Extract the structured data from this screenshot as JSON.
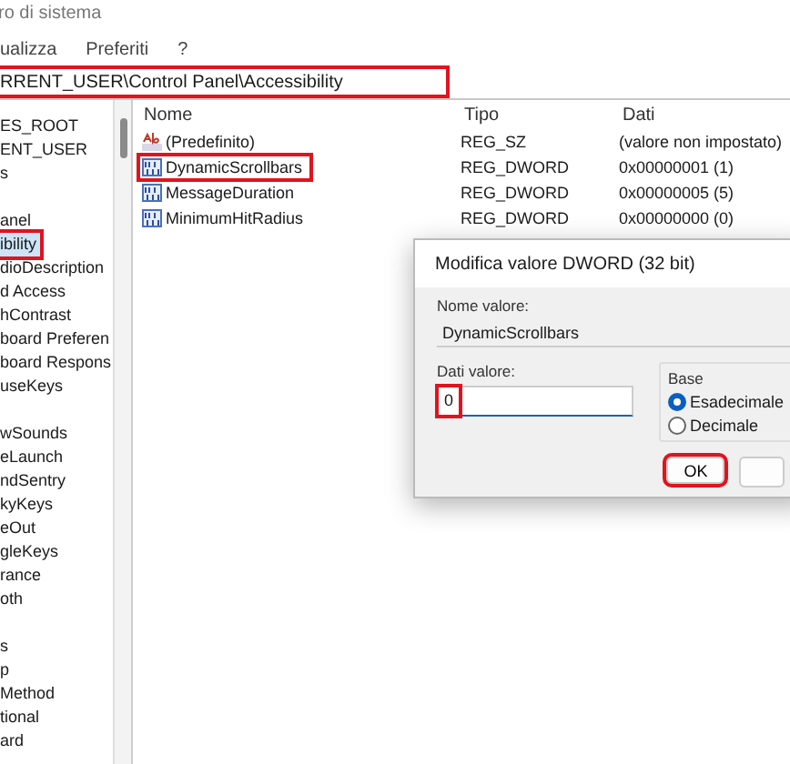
{
  "window": {
    "title": "ro di sistema"
  },
  "menu": [
    {
      "label": "ualizza"
    },
    {
      "label": "Preferiti"
    },
    {
      "label": "?"
    }
  ],
  "address": {
    "value": "RRENT_USER\\Control Panel\\Accessibility",
    "highlighted": true
  },
  "tree": [
    {
      "items": [
        {
          "label": "ES_ROOT",
          "selected": false,
          "highlighted": false
        },
        {
          "label": "ENT_USER",
          "selected": false,
          "highlighted": false
        },
        {
          "label": "s",
          "selected": false,
          "highlighted": false
        }
      ]
    },
    {
      "items": [
        {
          "label": "anel",
          "selected": false,
          "highlighted": false
        },
        {
          "label": "ibility",
          "selected": true,
          "highlighted": true
        },
        {
          "label": "dioDescription",
          "selected": false,
          "highlighted": false
        },
        {
          "label": "d Access",
          "selected": false,
          "highlighted": false
        },
        {
          "label": "hContrast",
          "selected": false,
          "highlighted": false
        },
        {
          "label": "board Preferen",
          "selected": false,
          "highlighted": false
        },
        {
          "label": "board Respons",
          "selected": false,
          "highlighted": false
        },
        {
          "label": "useKeys",
          "selected": false,
          "highlighted": false
        }
      ]
    },
    {
      "items": [
        {
          "label": "wSounds",
          "selected": false,
          "highlighted": false
        },
        {
          "label": "eLaunch",
          "selected": false,
          "highlighted": false
        },
        {
          "label": "ndSentry",
          "selected": false,
          "highlighted": false
        },
        {
          "label": "kyKeys",
          "selected": false,
          "highlighted": false
        },
        {
          "label": "eOut",
          "selected": false,
          "highlighted": false
        },
        {
          "label": "gleKeys",
          "selected": false,
          "highlighted": false
        },
        {
          "label": "rance",
          "selected": false,
          "highlighted": false
        },
        {
          "label": "oth",
          "selected": false,
          "highlighted": false
        }
      ]
    },
    {
      "items": [
        {
          "label": "s",
          "selected": false,
          "highlighted": false
        },
        {
          "label": "p",
          "selected": false,
          "highlighted": false
        },
        {
          "label": "Method",
          "selected": false,
          "highlighted": false
        },
        {
          "label": "tional",
          "selected": false,
          "highlighted": false
        },
        {
          "label": "ard",
          "selected": false,
          "highlighted": false
        }
      ]
    }
  ],
  "table": {
    "columns": [
      "Nome",
      "Tipo",
      "Dati"
    ],
    "rows": [
      {
        "kind": "string",
        "name": "(Predefinito)",
        "type": "REG_SZ",
        "data": "(valore non impostato)",
        "highlighted": false
      },
      {
        "kind": "dword",
        "name": "DynamicScrollbars",
        "type": "REG_DWORD",
        "data": "0x00000001 (1)",
        "highlighted": true
      },
      {
        "kind": "dword",
        "name": "MessageDuration",
        "type": "REG_DWORD",
        "data": "0x00000005 (5)",
        "highlighted": false
      },
      {
        "kind": "dword",
        "name": "MinimumHitRadius",
        "type": "REG_DWORD",
        "data": "0x00000000 (0)",
        "highlighted": false
      }
    ]
  },
  "dialog": {
    "title": "Modifica valore DWORD (32 bit)",
    "name_label": "Nome valore:",
    "name_value": "DynamicScrollbars",
    "data_label": "Dati valore:",
    "data_value": "0",
    "data_highlighted": true,
    "base_label": "Base",
    "bases": [
      {
        "label": "Esadecimale",
        "selected": true
      },
      {
        "label": "Decimale",
        "selected": false
      }
    ],
    "ok": {
      "label": "OK",
      "highlighted": true
    }
  }
}
